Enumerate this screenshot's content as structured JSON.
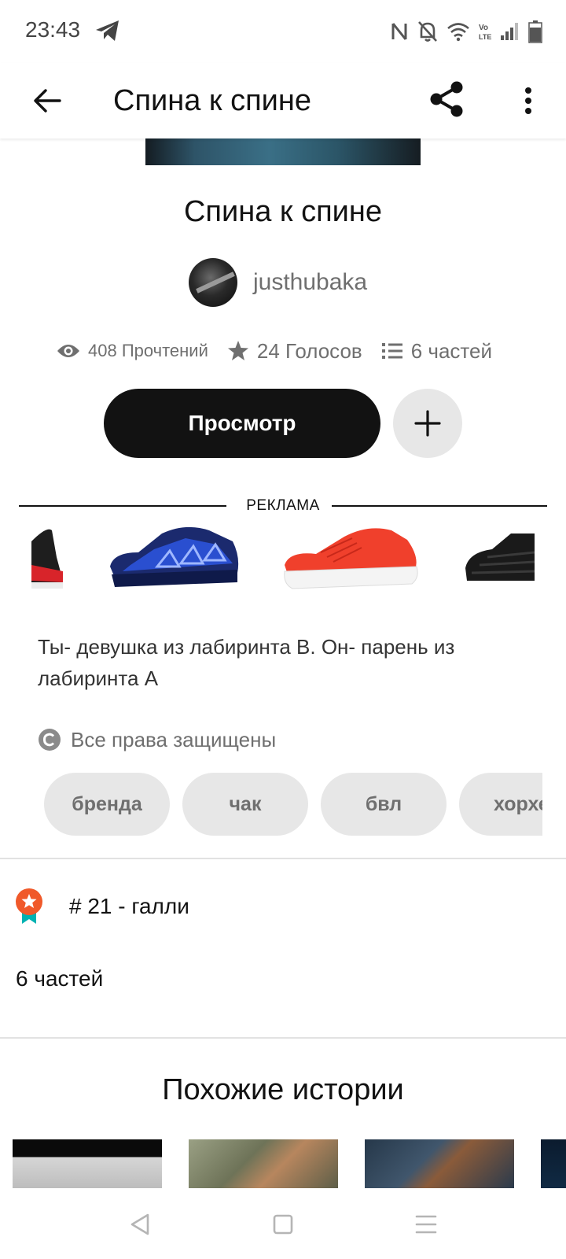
{
  "status_bar": {
    "time": "23:43",
    "icons": [
      "telegram-icon",
      "nfc-icon",
      "mute-icon",
      "wifi-icon",
      "volte-icon",
      "signal-icon",
      "battery-icon"
    ]
  },
  "app_bar": {
    "title": "Спина к спине",
    "back_icon": "arrow-left-icon",
    "share_icon": "share-icon",
    "more_icon": "more-vertical-icon"
  },
  "story": {
    "title": "Спина к спине",
    "author": "justhubaka",
    "stats": {
      "reads": "408 Прочтений",
      "votes": "24 Голосов",
      "parts": "6 частей"
    },
    "read_button": "Просмотр",
    "add_button_icon": "plus-icon",
    "description": "Ты- девушка из лабиринта В. Он- парень из лабиринта А",
    "rights": "Все права защищены",
    "tags": [
      "бренда",
      "чак",
      "бвл",
      "хорхе"
    ]
  },
  "ad": {
    "label": "РЕКЛАМА"
  },
  "ranking": {
    "text": "# 21 - галли",
    "icon": "award-badge-icon"
  },
  "parts_summary": "6 частей",
  "similar": {
    "title": "Похожие истории"
  },
  "colors": {
    "primary": "#121212",
    "muted": "#6f6f6f",
    "chip": "#e7e7e7",
    "badge_orange": "#f0592a",
    "badge_teal": "#00b2b2"
  }
}
